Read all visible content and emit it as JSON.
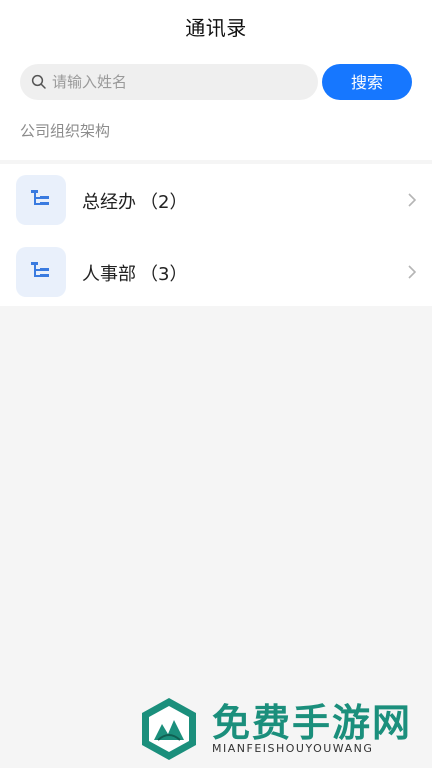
{
  "header": {
    "title": "通讯录"
  },
  "search": {
    "placeholder": "请输入姓名",
    "value": "",
    "button_label": "搜索",
    "icon": "search-icon"
  },
  "section": {
    "title": "公司组织架构"
  },
  "departments": [
    {
      "name": "总经办",
      "count": "（2）",
      "icon": "org-chart-icon"
    },
    {
      "name": "人事部",
      "count": "（3）",
      "icon": "org-chart-icon"
    }
  ],
  "watermark": {
    "title": "免费手游网",
    "subtitle": "MIANFEISHOUYOUWANG"
  },
  "colors": {
    "accent": "#1677ff",
    "icon_tile": "#e9f0fb",
    "watermark": "#1b8f7c"
  }
}
